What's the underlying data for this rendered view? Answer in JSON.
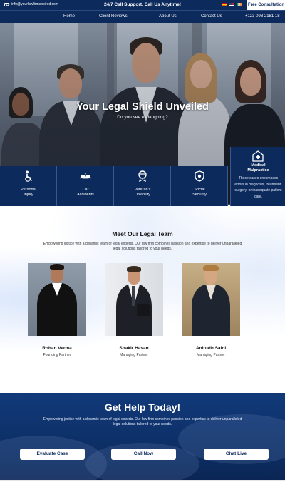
{
  "topbar": {
    "email": "info@yourlawfirmexpired.com",
    "support": "24/7 Call Support, Call Us Anytime!",
    "flags": [
      "es-flag-icon",
      "us-flag-icon",
      "ie-flag-icon"
    ],
    "cta": "Free Consultation"
  },
  "nav": {
    "items": [
      "Home",
      "Client Reviews",
      "About Us",
      "Contact Us"
    ],
    "phone": "+123 098 2181 18"
  },
  "hero": {
    "title": "Your Legal Shield Unveiled",
    "subtitle": "Do you see us laughing?"
  },
  "practice_areas": [
    {
      "label_1": "Personal",
      "label_2": "Injury",
      "icon": "injury-icon"
    },
    {
      "label_1": "Car",
      "label_2": "Accidents",
      "icon": "car-accident-icon"
    },
    {
      "label_1": "Veteran's",
      "label_2": "Disability",
      "icon": "veteran-icon"
    },
    {
      "label_1": "Social",
      "label_2": "Security",
      "icon": "social-security-icon"
    }
  ],
  "featured_area": {
    "label_1": "Medical",
    "label_2": "Malpractice",
    "description": "These cases encompass errors in diagnosis, treatment, surgery, or inadequate patient care.",
    "icon": "hospital-icon"
  },
  "team": {
    "heading": "Meet Our Legal Team",
    "intro": "Empowering justice with a dynamic team of legal experts. Our law firm combines passion and expertise to deliver unparalleled legal solutions tailored to your needs.",
    "members": [
      {
        "name": "Rohan Verma",
        "role": "Founding Partner"
      },
      {
        "name": "Shakir Hasan",
        "role": "Managing Partner"
      },
      {
        "name": "Anirudh Saini",
        "role": "Managing Partner"
      }
    ]
  },
  "help": {
    "heading": "Get Help Today!",
    "intro": "Empowering justice with a dynamic team of legal experts. Our law firm combines passion and expertise to deliver unparalleled legal solutions tailored to your needs.",
    "buttons": [
      "Evaluate Case",
      "Call Now",
      "Chat Live"
    ]
  },
  "colors": {
    "navy": "#0d2a5c",
    "help_blue": "#123a7a",
    "white": "#ffffff"
  }
}
